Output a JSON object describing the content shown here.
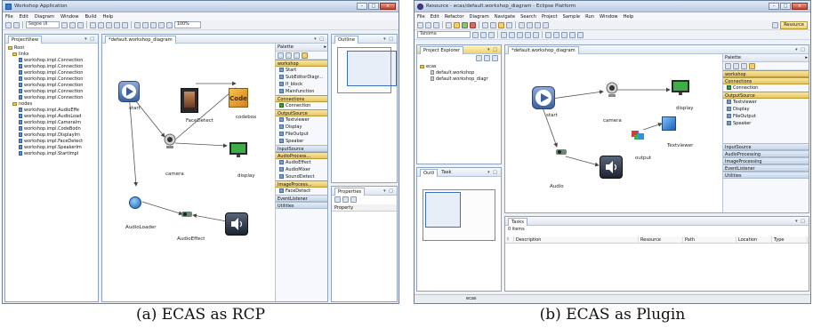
{
  "left": {
    "window_title": "Workshop Application",
    "menu": [
      "File",
      "Edit",
      "Diagram",
      "Window",
      "Build",
      "Help"
    ],
    "font_value": "Segoe UI",
    "zoom_value": "100%",
    "project_view_tab": "ProjectView",
    "tree": {
      "root": "Root",
      "links_folder": "links",
      "links": [
        "workshop.impl.Connection",
        "workshop.impl.Connection",
        "workshop.impl.Connection",
        "workshop.impl.Connection",
        "workshop.impl.Connection",
        "workshop.impl.Connection",
        "workshop.impl.Connection"
      ],
      "nodes_folder": "nodes",
      "nodes": [
        "workshop.impl.AudioEffe",
        "workshop.impl.AudioLoad",
        "workshop.impl.CameraIm",
        "workshop.impl.CodeBodn",
        "workshop.impl.DisplayIm",
        "workshop.impl.FaceDetect",
        "workshop.impl.SpeakerIm",
        "workshop.impl.StartImpl"
      ]
    },
    "editor_tab": "*default.workshop_diagram",
    "nodes": {
      "start": "start",
      "facedetect": "FaceDetect",
      "codebox": "codebox",
      "camera": "camera",
      "display": "display",
      "audioloader": "AudioLoader",
      "audioeffect": "AudioEffect"
    },
    "code_icon_text": "Code",
    "palette": {
      "title": "Palette",
      "drawers": [
        {
          "label": "workshop",
          "items": [
            "Start",
            "SubEditorDiagr...",
            "If_block",
            "Mainfunction"
          ]
        },
        {
          "label": "Connections",
          "items": [
            "Connection"
          ]
        },
        {
          "label": "OutputSource",
          "items": [
            "Textviewer",
            "Display",
            "FileOutput",
            "Speaker"
          ]
        },
        {
          "label": "InputSource",
          "items": []
        },
        {
          "label": "AudioProcess...",
          "items": [
            "AudioEffect",
            "AudioMixer",
            "SoundDetect"
          ]
        },
        {
          "label": "ImageProcess...",
          "items": [
            "FaceDetect"
          ]
        },
        {
          "label": "EventListener",
          "items": []
        },
        {
          "label": "Utilities",
          "items": []
        }
      ]
    },
    "outline_tab": "Outline",
    "properties_tab": "Properties",
    "properties_header": "Property"
  },
  "right": {
    "window_title": "Resource - ecas/default.workshop_diagram - Eclipse Platform",
    "menu": [
      "File",
      "Edit",
      "Refactor",
      "Diagram",
      "Navigate",
      "Search",
      "Project",
      "Sample",
      "Run",
      "Window",
      "Help"
    ],
    "font_value": "Tahoma",
    "perspective": "Resource",
    "project_explorer_tab": "Project Explorer",
    "tree": {
      "project": "ecas",
      "files": [
        "default.workshop",
        "default.workshop_diagr"
      ]
    },
    "editor_tab": "*default.workshop_diagram",
    "nodes": {
      "start": "start",
      "camera": "camera",
      "display": "display",
      "textviewer": "Textviewer",
      "output": "output",
      "audio": "Audio"
    },
    "palette": {
      "title": "Palette",
      "drawers": [
        {
          "label": "workshop",
          "items": []
        },
        {
          "label": "Connections",
          "items": [
            "Connection"
          ]
        },
        {
          "label": "OutputSource",
          "items": [
            "Textviewer",
            "Display",
            "FileOutput",
            "Speaker"
          ]
        },
        {
          "label": "InputSource",
          "items": []
        },
        {
          "label": "AudioProcessing",
          "items": []
        },
        {
          "label": "ImageProcessing",
          "items": []
        },
        {
          "label": "EventListener",
          "items": []
        },
        {
          "label": "Utilities",
          "items": []
        }
      ]
    },
    "outline_tab": "Outli",
    "task_tab": "Task",
    "tasks": {
      "tab": "Tasks",
      "count": "0 items",
      "columns": [
        "!",
        "Description",
        "Resource",
        "Path",
        "Location",
        "Type"
      ]
    },
    "status_text": "ecas"
  },
  "captions": {
    "left": "(a) ECAS as RCP",
    "right": "(b) ECAS as Plugin"
  },
  "colors": {
    "titlebar": "#c9d8ec",
    "selection": "#3b6fb6",
    "palette_open": "#e9c85a"
  }
}
